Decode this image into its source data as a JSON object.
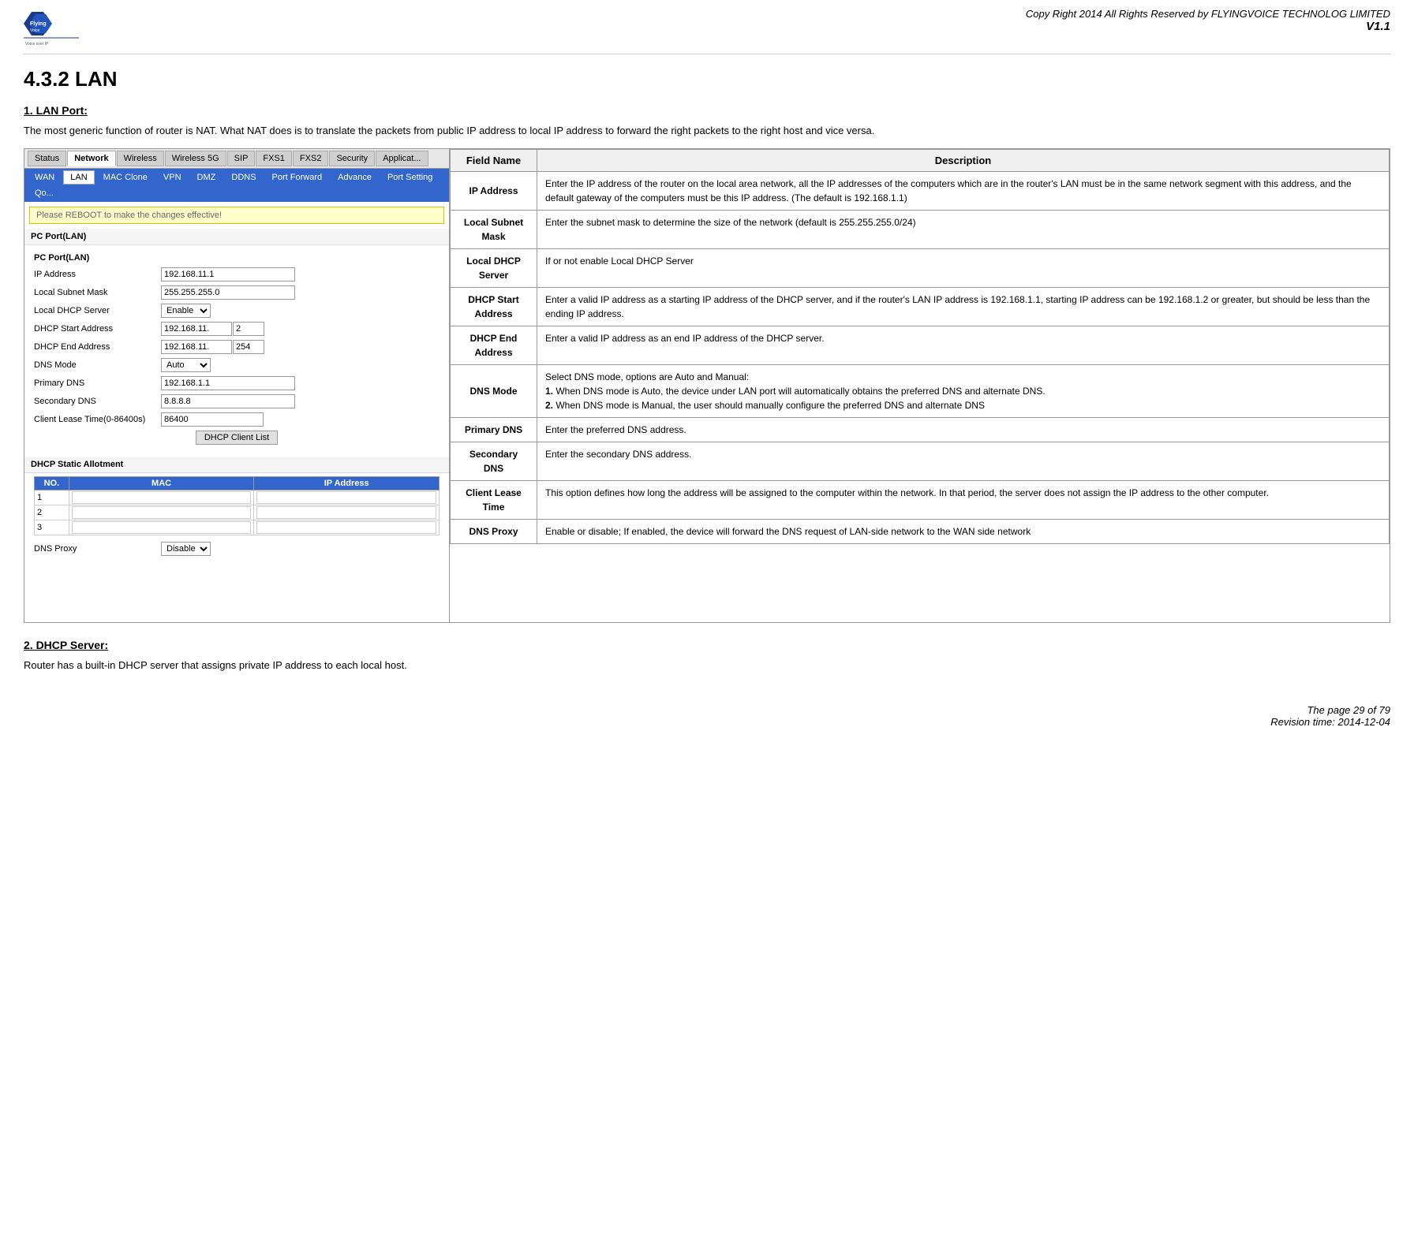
{
  "header": {
    "copyright": "Copy Right 2014 All Rights Reserved by FLYINGVOICE TECHNOLOG LIMITED",
    "version": "V1.1"
  },
  "section": {
    "title": "4.3.2 LAN",
    "sub1_title": "1.  LAN Port:",
    "sub1_text": "The most generic function of router is NAT. What NAT does is to translate the packets from public IP address to local IP address to forward the right packets to the right host and vice versa.",
    "sub2_title": "2.  DHCP Server:",
    "sub2_text": "Router has a built-in DHCP server that assigns private IP address to each local host."
  },
  "router_ui": {
    "nav_tabs": [
      "Status",
      "Network",
      "Wireless",
      "Wireless 5G",
      "SIP",
      "FXS1",
      "FXS2",
      "Security",
      "Applicat..."
    ],
    "active_nav": "Network",
    "sub_tabs": [
      "WAN",
      "LAN",
      "MAC Clone",
      "VPN",
      "DMZ",
      "DDNS",
      "Port Forward",
      "Advance",
      "Port Setting",
      "Qo..."
    ],
    "active_sub": "LAN",
    "reboot_notice": "Please REBOOT to make the changes effective!",
    "section_title": "PC Port(LAN)",
    "form_section_title": "PC Port(LAN)",
    "fields": [
      {
        "label": "IP Address",
        "value": "192.168.11.1",
        "type": "text"
      },
      {
        "label": "Local Subnet Mask",
        "value": "255.255.255.0",
        "type": "text"
      },
      {
        "label": "Local DHCP Server",
        "value": "Enable",
        "type": "select"
      },
      {
        "label": "DHCP Start Address",
        "value1": "192.168.11.",
        "value2": "2",
        "type": "ip_split"
      },
      {
        "label": "DHCP End Address",
        "value1": "192.168.11.",
        "value2": "254",
        "type": "ip_split"
      },
      {
        "label": "DNS Mode",
        "value": "Auto",
        "type": "select"
      },
      {
        "label": "Primary DNS",
        "value": "192.168.1.1",
        "type": "text"
      },
      {
        "label": "Secondary DNS",
        "value": "8.8.8.8",
        "type": "text"
      },
      {
        "label": "Client Lease Time(0-86400s)",
        "value": "86400",
        "type": "text"
      }
    ],
    "dhcp_client_list_btn": "DHCP Client List",
    "static_allotment_title": "DHCP Static Allotment",
    "static_table": {
      "headers": [
        "NO.",
        "MAC",
        "IP Address"
      ],
      "rows": [
        {
          "no": "1",
          "mac": "",
          "ip": ""
        },
        {
          "no": "2",
          "mac": "",
          "ip": ""
        },
        {
          "no": "3",
          "mac": "",
          "ip": ""
        }
      ]
    },
    "dns_proxy_label": "DNS Proxy",
    "dns_proxy_value": "Disable"
  },
  "description_table": {
    "col_field": "Field Name",
    "col_desc": "Description",
    "rows": [
      {
        "field": "IP Address",
        "desc": "Enter the IP address of the router on the local area network, all the IP addresses of the computers which are in the router's LAN must be in the same network segment with this address, and the default gateway of the computers must be this IP address. (The default is 192.168.1.1)"
      },
      {
        "field": "Local Subnet Mask",
        "desc": "Enter the subnet mask to determine the size of the network (default is 255.255.255.0/24)"
      },
      {
        "field": "Local DHCP Server",
        "desc": "If or not enable Local DHCP Server"
      },
      {
        "field": "DHCP Start Address",
        "desc": "Enter a valid IP address as a starting IP address of the DHCP server, and if the router's LAN IP address is 192.168.1.1, starting IP address can be 192.168.1.2 or greater, but should be less than the ending IP address."
      },
      {
        "field": "DHCP End Address",
        "desc": "Enter a valid IP address as an end IP address of the DHCP server."
      },
      {
        "field": "DNS Mode",
        "desc": "Select DNS mode, options are Auto and Manual:\n1. When DNS mode is Auto, the device under LAN port will automatically obtains the preferred DNS and alternate DNS.\n2. When DNS mode is Manual, the user should manually configure the preferred DNS and alternate DNS"
      },
      {
        "field": "Primary DNS",
        "desc": "Enter the preferred DNS address."
      },
      {
        "field": "Secondary DNS",
        "desc": "Enter the secondary DNS address."
      },
      {
        "field": "Client Lease Time",
        "desc": "This option defines how long the address will be assigned to the computer within the network. In that period, the server does not assign the IP address to the other computer."
      },
      {
        "field": "DNS Proxy",
        "desc": "Enable or disable; If enabled, the device will forward the DNS request of LAN-side network to the WAN side network"
      }
    ]
  },
  "footer": {
    "page": "The page 29 of 79",
    "revision": "Revision time: 2014-12-04"
  }
}
